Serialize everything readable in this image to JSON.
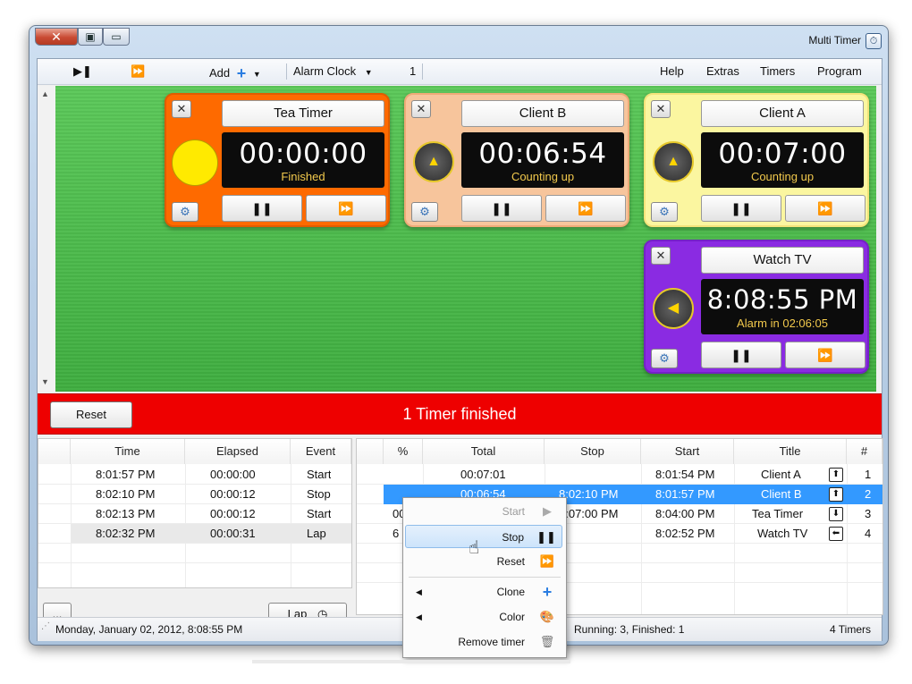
{
  "window": {
    "title": "Multi Timer",
    "controls": {
      "close": "✕",
      "restore": "▣",
      "minimize": "▭"
    },
    "icon": "stopwatch-icon"
  },
  "menubar": {
    "menus": [
      "Program",
      "Timers",
      "Extras",
      "Help"
    ],
    "toolbar": {
      "count": "1",
      "alarm_clock": "Alarm Clock",
      "add": "Add",
      "fast_forward": "⏩",
      "play_pause": "⏯"
    }
  },
  "timers": [
    {
      "title": "Client A",
      "time": "00:07:00",
      "status": "Counting up",
      "bg": "#fbf6a0",
      "border": "#f3e37a"
    },
    {
      "title": "Client B",
      "time": "00:06:54",
      "status": "Counting up",
      "bg": "#f7c59c",
      "border": "#eeaa77"
    },
    {
      "title": "Tea Timer",
      "time": "00:00:00",
      "status": "Finished",
      "bg": "#fe6a00",
      "border": "#e05c00"
    },
    {
      "title": "Watch TV",
      "time": "8:08:55 PM",
      "status": "Alarm in 02:06:05",
      "bg": "#8a2be2",
      "border": "#7422c6"
    }
  ],
  "timer_buttons": {
    "pause": "❚❚",
    "reset": "⏩"
  },
  "banner": {
    "text": "1 Timer finished",
    "reset_label": "Reset",
    "color": "#ee0000"
  },
  "main_table": {
    "headers": [
      "#",
      "Title",
      "Start",
      "Stop",
      "Total",
      "%"
    ],
    "rows": [
      {
        "num": "1",
        "title": "Client A",
        "start": "8:01:54 PM",
        "stop": "",
        "total": "00:07:01",
        "pct": ""
      },
      {
        "num": "2",
        "title": "Client B",
        "start": "8:01:57 PM",
        "stop": "8:02:10 PM",
        "total": "00:06:54",
        "pct": ""
      },
      {
        "num": "3",
        "title": "Tea Timer",
        "start": "8:04:00 PM",
        "stop": "8:07:00 PM",
        "total": "00",
        "pct": ""
      },
      {
        "num": "4",
        "title": "Watch TV",
        "start": "8:02:52 PM",
        "stop": "",
        "total": "",
        "pct": "6"
      }
    ]
  },
  "log_table": {
    "headers": [
      "Event",
      "Elapsed",
      "Time"
    ],
    "rows": [
      {
        "event": "Start",
        "elapsed": "00:00:00",
        "time": "8:01:57 PM"
      },
      {
        "event": "Stop",
        "elapsed": "00:00:12",
        "time": "8:02:10 PM"
      },
      {
        "event": "Start",
        "elapsed": "00:00:12",
        "time": "8:02:13 PM"
      },
      {
        "event": "Lap",
        "elapsed": "00:00:31",
        "time": "8:02:32 PM"
      }
    ],
    "lap_label": "Lap",
    "more_label": "..."
  },
  "statusbar": {
    "timers_count": "4 Timers",
    "running": "Running: 3, Finished: 1",
    "datetime": "Monday, January 02, 2012, 8:08:55 PM"
  },
  "context_menu": {
    "items": [
      {
        "label": "Start",
        "icon": "▶",
        "disabled": true
      },
      {
        "label": "Stop",
        "icon": "❚❚"
      },
      {
        "label": "Reset",
        "icon": "⏩"
      },
      {
        "label": "Clone",
        "icon": "+",
        "submenu": true
      },
      {
        "label": "Color",
        "icon": "🎨",
        "submenu": true
      },
      {
        "label": "Remove timer",
        "icon": "🗑"
      }
    ]
  }
}
